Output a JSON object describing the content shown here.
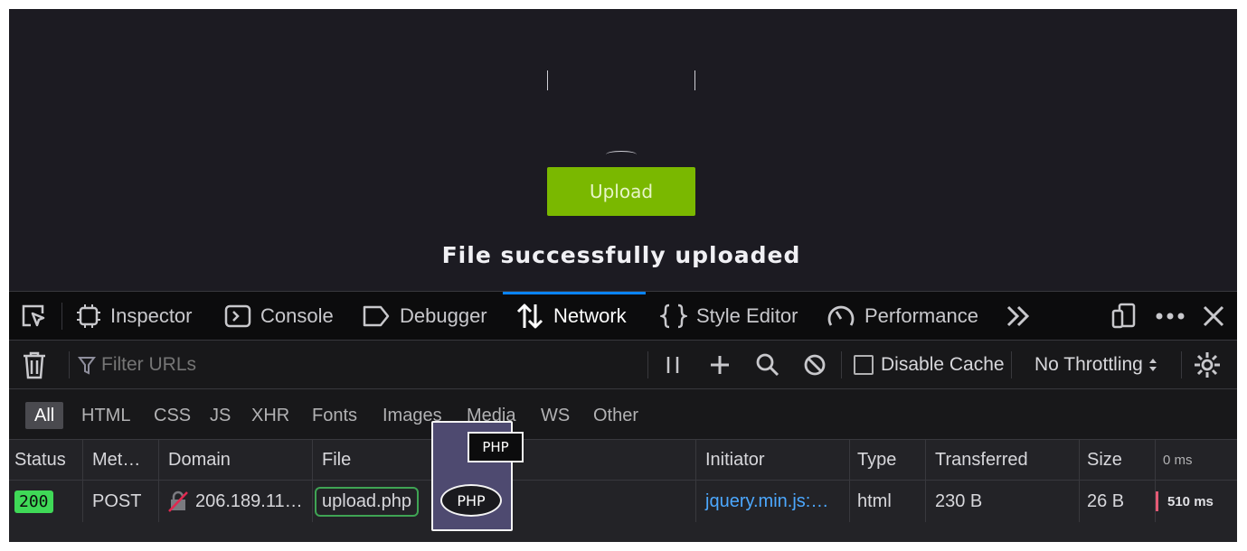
{
  "page": {
    "upload_button": "Upload",
    "status_message": "File successfully uploaded"
  },
  "devtools": {
    "tabs": [
      {
        "label": "Inspector",
        "icon": "inspector-icon"
      },
      {
        "label": "Console",
        "icon": "console-icon"
      },
      {
        "label": "Debugger",
        "icon": "debugger-icon"
      },
      {
        "label": "Network",
        "icon": "network-icon",
        "selected": true
      },
      {
        "label": "Style Editor",
        "icon": "style-editor-icon"
      },
      {
        "label": "Performance",
        "icon": "performance-icon"
      }
    ],
    "accent_color": "#0a84ff"
  },
  "network": {
    "filter_placeholder": "Filter URLs",
    "disable_cache_label": "Disable Cache",
    "throttling": "No Throttling",
    "type_filters": [
      "All",
      "HTML",
      "CSS",
      "JS",
      "XHR",
      "Fonts",
      "Images",
      "Media",
      "WS",
      "Other"
    ],
    "columns": [
      "Status",
      "Met…",
      "Domain",
      "File",
      "Initiator",
      "Type",
      "Transferred",
      "Size",
      "0 ms"
    ],
    "rows": [
      {
        "status": "200",
        "method": "POST",
        "domain": "206.189.11…",
        "file": "upload.php",
        "initiator": "jquery.min.js:…",
        "type": "html",
        "transferred": "230 B",
        "size": "26 B",
        "waterfall": "510 ms"
      }
    ],
    "status_ok_color": "#3fd957"
  },
  "overlay": {
    "tag_text": "PHP",
    "oval_text": "PHP"
  }
}
